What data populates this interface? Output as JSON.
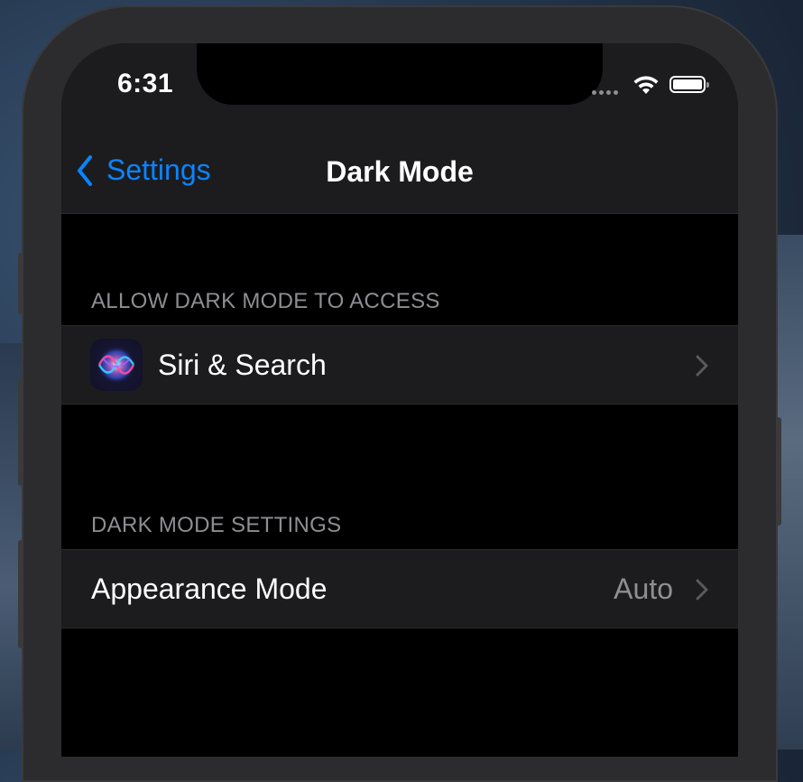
{
  "status_bar": {
    "time": "6:31"
  },
  "nav": {
    "back_label": "Settings",
    "title": "Dark Mode"
  },
  "sections": [
    {
      "header": "ALLOW DARK MODE TO ACCESS",
      "rows": [
        {
          "label": "Siri & Search",
          "icon": "siri-icon"
        }
      ]
    },
    {
      "header": "DARK MODE SETTINGS",
      "rows": [
        {
          "label": "Appearance Mode",
          "value": "Auto"
        }
      ]
    }
  ],
  "colors": {
    "accent": "#0a84ff",
    "background": "#000000",
    "cell": "#1c1c1e",
    "secondary_text": "#8e8e93"
  }
}
